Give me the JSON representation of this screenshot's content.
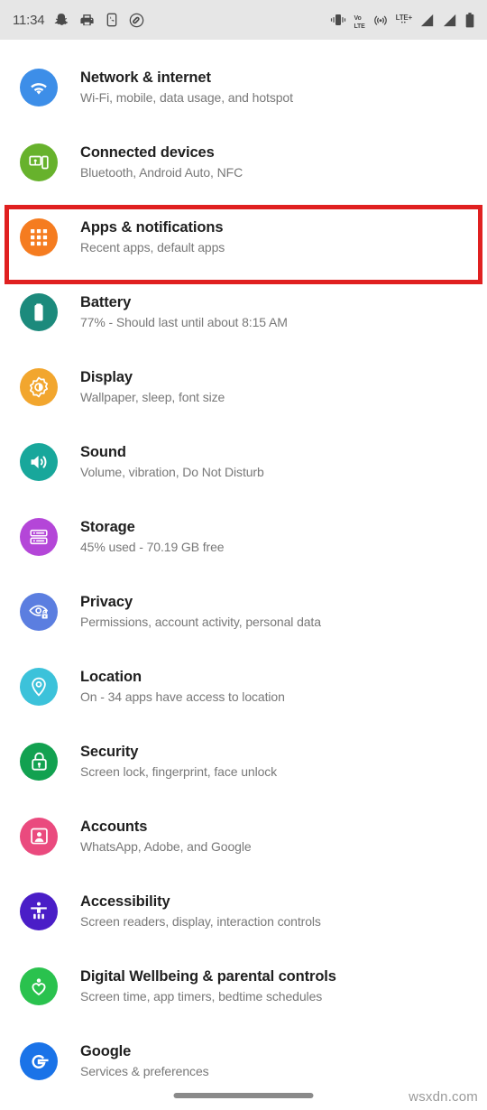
{
  "status_bar": {
    "clock": "11:34",
    "left_icons": [
      {
        "name": "snapchat-icon",
        "glyph": "ghost"
      },
      {
        "name": "printer-icon",
        "glyph": "printer"
      },
      {
        "name": "phone-app-icon",
        "glyph": "phone"
      },
      {
        "name": "shazam-icon",
        "glyph": "shazam"
      }
    ],
    "right_icons": [
      {
        "name": "vibrate-icon",
        "glyph": "vibrate"
      },
      {
        "name": "volte-icon",
        "label_top": "VoLTE",
        "label_line1": "VoLTE",
        "label_line2": "LTE",
        "label_a": "Vo",
        "label_b": "LTE"
      },
      {
        "name": "hotspot-icon",
        "glyph": "hotspot"
      },
      {
        "name": "lte-plus-icon",
        "label": "LTE+",
        "dots": "••"
      },
      {
        "name": "signal-sim1-icon",
        "glyph": "signal"
      },
      {
        "name": "signal-sim2-icon",
        "glyph": "signal"
      },
      {
        "name": "battery-icon",
        "glyph": "battery"
      }
    ]
  },
  "highlight": {
    "color": "#e02020",
    "target": "Apps & notifications"
  },
  "bottom": {
    "watermark": "wsxdn.com"
  },
  "settings": {
    "items": [
      {
        "id": "network-internet",
        "title": "Network & internet",
        "subtitle": "Wi-Fi, mobile, data usage, and hotspot",
        "icon": "wifi-icon",
        "color": "#3d8ee8",
        "highlighted": false
      },
      {
        "id": "connected-devices",
        "title": "Connected devices",
        "subtitle": "Bluetooth, Android Auto, NFC",
        "icon": "devices-icon",
        "color": "#67b22c",
        "highlighted": false
      },
      {
        "id": "apps-notifications",
        "title": "Apps & notifications",
        "subtitle": "Recent apps, default apps",
        "icon": "apps-grid-icon",
        "color": "#f57c20",
        "highlighted": true
      },
      {
        "id": "battery",
        "title": "Battery",
        "subtitle": "77% - Should last until about 8:15 AM",
        "icon": "battery-icon",
        "color": "#1c8a7c",
        "highlighted": false
      },
      {
        "id": "display",
        "title": "Display",
        "subtitle": "Wallpaper, sleep, font size",
        "icon": "brightness-icon",
        "color": "#f2a62e",
        "highlighted": false
      },
      {
        "id": "sound",
        "title": "Sound",
        "subtitle": "Volume, vibration, Do Not Disturb",
        "icon": "speaker-icon",
        "color": "#18a79b",
        "highlighted": false
      },
      {
        "id": "storage",
        "title": "Storage",
        "subtitle": "45% used - 70.19 GB free",
        "icon": "storage-icon",
        "color": "#b446d8",
        "highlighted": false
      },
      {
        "id": "privacy",
        "title": "Privacy",
        "subtitle": "Permissions, account activity, personal data",
        "icon": "eye-lock-icon",
        "color": "#5b7ee0",
        "highlighted": false
      },
      {
        "id": "location",
        "title": "Location",
        "subtitle": "On - 34 apps have access to location",
        "icon": "location-pin-icon",
        "color": "#3cc2da",
        "highlighted": false
      },
      {
        "id": "security",
        "title": "Security",
        "subtitle": "Screen lock, fingerprint, face unlock",
        "icon": "lock-icon",
        "color": "#12a150",
        "highlighted": false
      },
      {
        "id": "accounts",
        "title": "Accounts",
        "subtitle": "WhatsApp, Adobe, and Google",
        "icon": "account-icon",
        "color": "#ea4a7e",
        "highlighted": false
      },
      {
        "id": "accessibility",
        "title": "Accessibility",
        "subtitle": "Screen readers, display, interaction controls",
        "icon": "accessibility-icon",
        "color": "#4a1ec7",
        "highlighted": false
      },
      {
        "id": "digital-wellbeing",
        "title": "Digital Wellbeing & parental controls",
        "subtitle": "Screen time, app timers, bedtime schedules",
        "icon": "wellbeing-heart-icon",
        "color": "#2ac24e",
        "highlighted": false
      },
      {
        "id": "google",
        "title": "Google",
        "subtitle": "Services & preferences",
        "icon": "google-g-icon",
        "color": "#1a73e8",
        "highlighted": false
      }
    ]
  }
}
